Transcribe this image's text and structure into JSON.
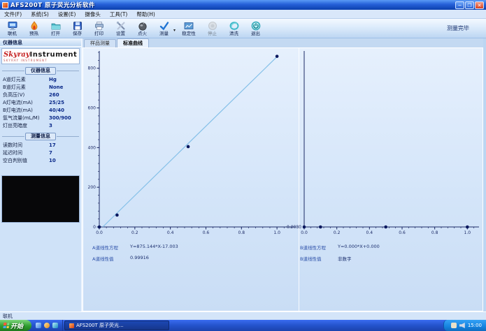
{
  "window": {
    "title": "AFS200T 原子荧光分析软件"
  },
  "menu_items": [
    "文件(F)",
    "系统(S)",
    "设置(E)",
    "摄像头",
    "工具(T)",
    "帮助(H)"
  ],
  "toolbar": {
    "status_text": "测量完毕",
    "buttons": [
      {
        "name": "connect",
        "label": "联机",
        "icon": "computer-icon",
        "disabled": false,
        "dropdown": false
      },
      {
        "name": "preheat",
        "label": "预热",
        "icon": "preheat-flame-icon",
        "disabled": false,
        "dropdown": false
      },
      {
        "name": "open",
        "label": "打开",
        "icon": "folder-open-icon",
        "disabled": false,
        "dropdown": false
      },
      {
        "name": "save",
        "label": "保存",
        "icon": "floppy-save-icon",
        "disabled": false,
        "dropdown": false
      },
      {
        "name": "print",
        "label": "打印",
        "icon": "printer-icon",
        "disabled": false,
        "dropdown": false
      },
      {
        "name": "settings",
        "label": "设置",
        "icon": "tools-icon",
        "disabled": false,
        "dropdown": false
      },
      {
        "name": "ignite",
        "label": "点火",
        "icon": "ignite-sphere-icon",
        "disabled": false,
        "dropdown": false
      },
      {
        "name": "measure",
        "label": "测量",
        "icon": "check-icon",
        "disabled": false,
        "dropdown": true
      },
      {
        "name": "stability",
        "label": "稳定性",
        "icon": "stability-chart-icon",
        "disabled": false,
        "dropdown": false
      },
      {
        "name": "stop",
        "label": "停止",
        "icon": "stop-circle-icon",
        "disabled": true,
        "dropdown": false
      },
      {
        "name": "clean",
        "label": "清洗",
        "icon": "clean-swirl-icon",
        "disabled": false,
        "dropdown": false
      },
      {
        "name": "exit",
        "label": "退出",
        "icon": "power-exit-icon",
        "disabled": false,
        "dropdown": false
      }
    ]
  },
  "sidebar": {
    "panel_title": "仪器信息",
    "logo": {
      "brand": "Skyray",
      "suffix": "Instrument",
      "subtitle": "SKYRAY INSTRUMENT"
    },
    "sections": [
      {
        "title": "仪器信息",
        "rows": [
          {
            "label": "A道灯元素",
            "value": "Hg"
          },
          {
            "label": "B道灯元素",
            "value": "None"
          },
          {
            "label": "负高压(V)",
            "value": "260"
          },
          {
            "label": "A灯电流(mA)",
            "value": "25/25"
          },
          {
            "label": "B灯电流(mA)",
            "value": "40/40"
          },
          {
            "label": "氩气流量(mL/M)",
            "value": "300/900"
          },
          {
            "label": "灯丝亮暗度",
            "value": "3"
          }
        ]
      },
      {
        "title": "测量信息",
        "rows": [
          {
            "label": "读数时间",
            "value": "17"
          },
          {
            "label": "延迟时间",
            "value": "7"
          },
          {
            "label": "空白判别值",
            "value": "10"
          }
        ]
      }
    ]
  },
  "tabs": [
    {
      "name": "sample-measure",
      "label": "样品测量",
      "active": false
    },
    {
      "name": "standard-curve",
      "label": "标准曲线",
      "active": true
    }
  ],
  "chart_data": [
    {
      "type": "scatter",
      "name": "A道标准曲线",
      "x": [
        0.0,
        0.1,
        0.5,
        1.0
      ],
      "y": [
        0,
        60,
        405,
        860
      ],
      "fit": {
        "slope": 875.144,
        "intercept": -17.003
      },
      "xticks": [
        0,
        0.2,
        0.4,
        0.6,
        0.8,
        1.0
      ],
      "yticks": [
        0,
        200,
        400,
        600,
        800
      ],
      "xminor": 0.04,
      "yminor": 40,
      "xlim": [
        0,
        1.09
      ],
      "ylim": [
        0,
        880
      ],
      "grid": false,
      "equation_label": "A道线性方程",
      "equation": "Y=875.144*X-17.003",
      "r_label": "A道线性值",
      "r_value": "0.99916"
    },
    {
      "type": "scatter",
      "name": "B道标准曲线",
      "x": [
        0.0,
        0.1,
        0.5,
        1.0
      ],
      "y": [
        0,
        0,
        0,
        0
      ],
      "xticks": [
        0,
        0.2,
        0.4,
        0.6,
        0.8,
        1.0
      ],
      "yticks": [],
      "xminor": 0.04,
      "yminor": 0,
      "xlim": [
        0,
        1.05
      ],
      "ylim": [
        0,
        880
      ],
      "grid": false,
      "origin_label": "0.0080",
      "equation_label": "B道线性方程",
      "equation": "Y=0.000*X+0.000",
      "r_label": "B道线性值",
      "r_value": "非数字"
    }
  ],
  "status_bar": {
    "text": "联机"
  },
  "taskbar": {
    "start_label": "开始",
    "task_label": "AFS200T 原子荧光...",
    "clock": "15:00"
  }
}
